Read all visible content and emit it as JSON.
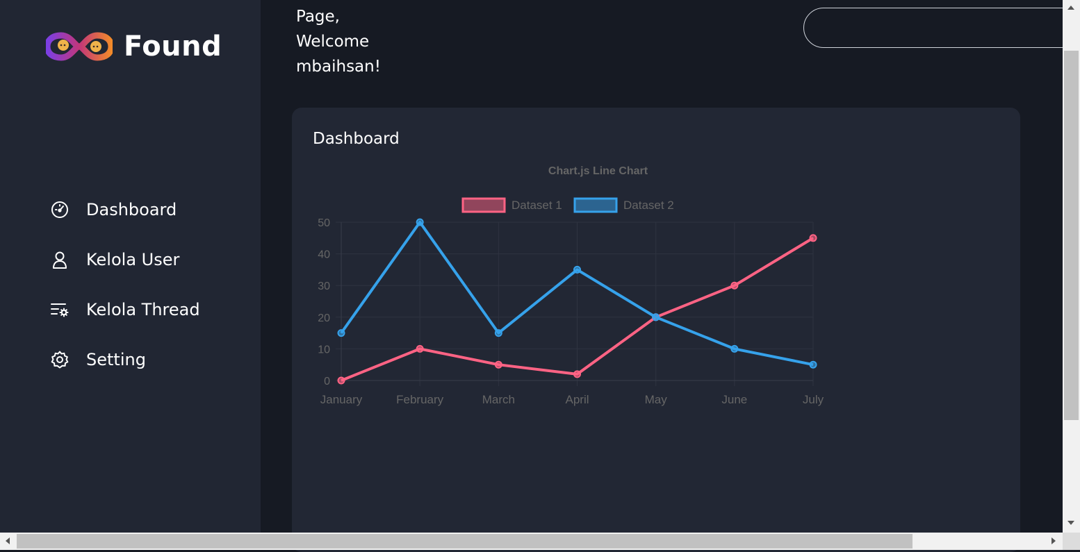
{
  "brand": {
    "name": "Found"
  },
  "sidebar": {
    "items": [
      {
        "label": "Dashboard",
        "icon": "gauge-icon"
      },
      {
        "label": "Kelola User",
        "icon": "user-icon"
      },
      {
        "label": "Kelola Thread",
        "icon": "list-settings-icon"
      },
      {
        "label": "Setting",
        "icon": "gear-icon"
      }
    ]
  },
  "header": {
    "welcome_line1": "Page,",
    "welcome_line2": "Welcome",
    "welcome_line3": "mbaihsan!",
    "search_placeholder": ""
  },
  "card": {
    "title": "Dashboard"
  },
  "colors": {
    "sidebar_bg": "#212633",
    "page_bg": "#161a23",
    "card_bg": "#222734",
    "series1": "#ff6384",
    "series2": "#36a2eb"
  },
  "chart_data": {
    "type": "line",
    "title": "Chart.js Line Chart",
    "categories": [
      "January",
      "February",
      "March",
      "April",
      "May",
      "June",
      "July"
    ],
    "series": [
      {
        "name": "Dataset 1",
        "color": "#ff6384",
        "values": [
          0,
          10,
          5,
          2,
          20,
          30,
          45
        ]
      },
      {
        "name": "Dataset 2",
        "color": "#36a2eb",
        "values": [
          15,
          50,
          15,
          35,
          20,
          10,
          5
        ]
      }
    ],
    "yticks": [
      "0",
      "10",
      "20",
      "30",
      "40",
      "50"
    ],
    "ylim": [
      0,
      50
    ],
    "grid": true,
    "legend": "top"
  }
}
